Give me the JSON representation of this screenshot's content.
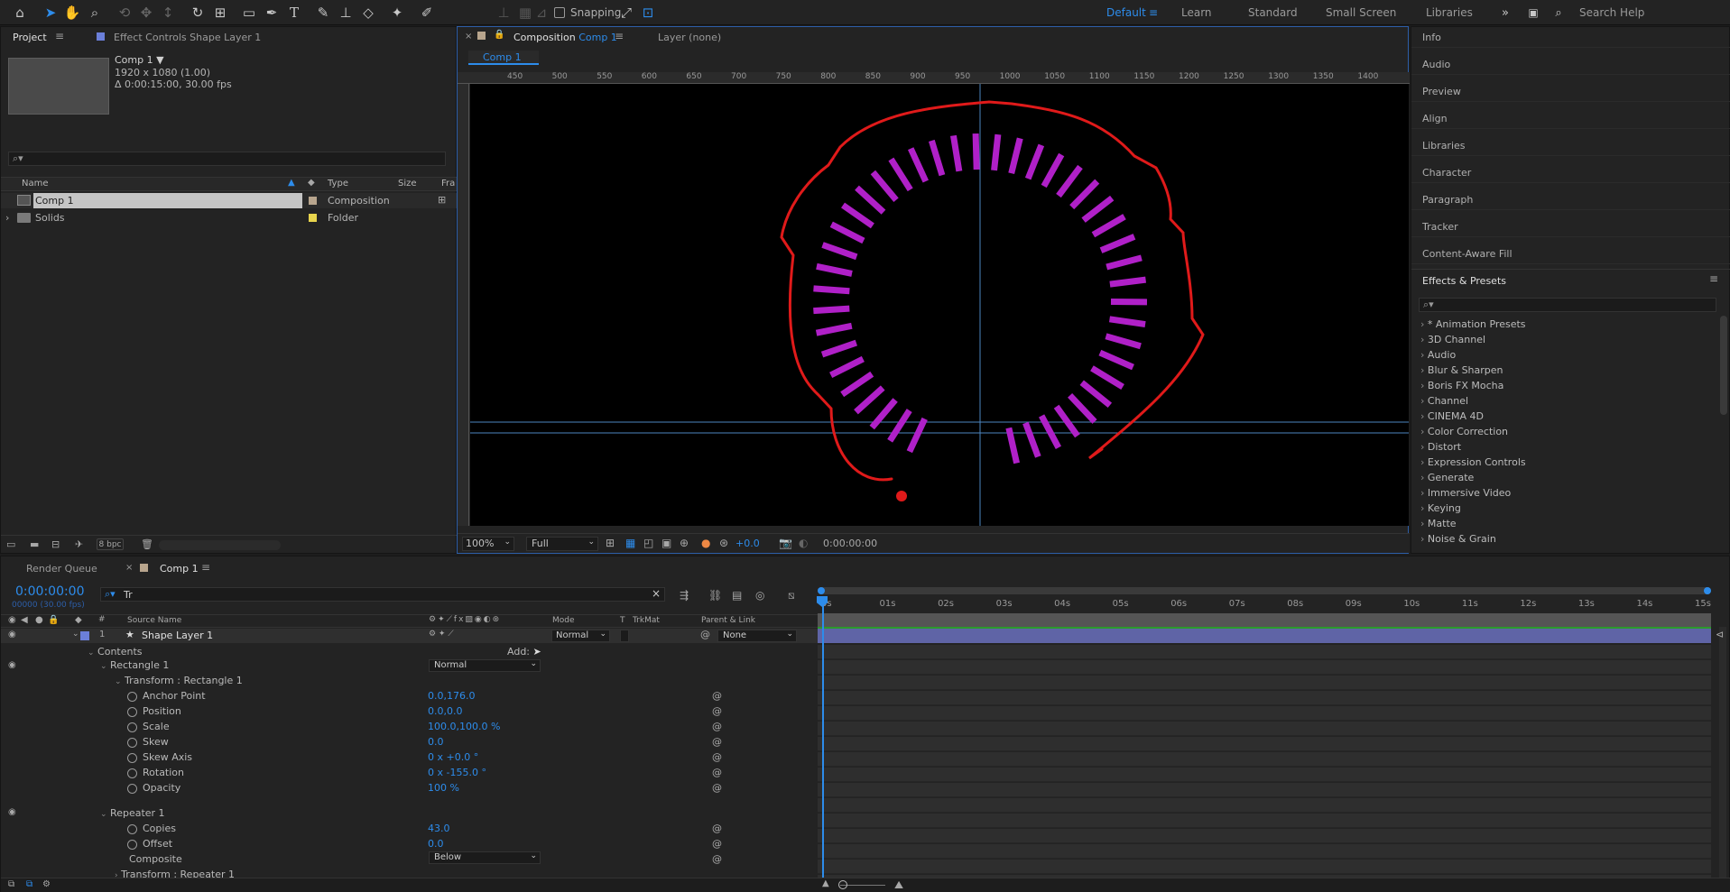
{
  "toolbar": {
    "snapping_label": "Snapping",
    "workspaces": [
      "Default",
      "Learn",
      "Standard",
      "Small Screen",
      "Libraries"
    ],
    "search_placeholder": "Search Help"
  },
  "project": {
    "tab_label": "Project",
    "effect_controls_tab": "Effect Controls Shape Layer 1",
    "comp_name": "Comp 1 ▼",
    "comp_res": "1920 x 1080 (1.00)",
    "comp_dur": "Δ 0:00:15:00, 30.00 fps",
    "search_placeholder": "",
    "columns": [
      "Name",
      "Type",
      "Size",
      "Fra"
    ],
    "items": [
      {
        "name": "Comp 1",
        "type": "Composition"
      },
      {
        "name": "Solids",
        "type": "Folder"
      }
    ],
    "bpc": "8 bpc"
  },
  "composition": {
    "tab_label": "Composition",
    "tab_comp": "Comp 1",
    "layer_tab": "Layer (none)",
    "subtab": "Comp 1",
    "ruler": [
      "450",
      "500",
      "550",
      "600",
      "650",
      "700",
      "750",
      "800",
      "850",
      "900",
      "950",
      "1000",
      "1050",
      "1100",
      "1150",
      "1200",
      "1250",
      "1300",
      "1350",
      "1400"
    ],
    "zoom": "100%",
    "resolution": "Full",
    "exposure": "+0.0",
    "timecode": "0:00:00:00",
    "circle": {
      "bars": 43,
      "bar_color": "#b020c8",
      "stroke_color": "#e01a1a"
    }
  },
  "right_panel": {
    "items": [
      "Info",
      "Audio",
      "Preview",
      "Align",
      "Libraries",
      "Character",
      "Paragraph",
      "Tracker",
      "Content-Aware Fill"
    ],
    "effects_title": "Effects & Presets",
    "effects_search": "",
    "effects": [
      "* Animation Presets",
      "3D Channel",
      "Audio",
      "Blur & Sharpen",
      "Boris FX Mocha",
      "Channel",
      "CINEMA 4D",
      "Color Correction",
      "Distort",
      "Expression Controls",
      "Generate",
      "Immersive Video",
      "Keying",
      "Matte",
      "Noise & Grain"
    ]
  },
  "timeline": {
    "render_queue_tab": "Render Queue",
    "comp_tab": "Comp 1",
    "timecode": "0:00:00:00",
    "frame_info": "00000 (30.00 fps)",
    "search_value": "Tr",
    "col_num": "#",
    "col_source": "Source Name",
    "col_mode": "Mode",
    "col_t": "T",
    "col_trkmat": "TrkMat",
    "col_parent": "Parent & Link",
    "layer": {
      "num": "1",
      "name": "Shape Layer 1",
      "mode": "Normal",
      "parent": "None"
    },
    "contents_label": "Contents",
    "add_label": "Add:",
    "rect_label": "Rectangle 1",
    "rect_mode": "Normal",
    "transform_label": "Transform : Rectangle 1",
    "props": [
      {
        "name": "Anchor Point",
        "value": "0.0,176.0"
      },
      {
        "name": "Position",
        "value": "0.0,0.0"
      },
      {
        "name": "Scale",
        "value": "100.0,100.0 %"
      },
      {
        "name": "Skew",
        "value": "0.0"
      },
      {
        "name": "Skew Axis",
        "value": "0 x +0.0 °"
      },
      {
        "name": "Rotation",
        "value": "0 x -155.0 °"
      },
      {
        "name": "Opacity",
        "value": "100 %"
      }
    ],
    "repeater_label": "Repeater 1",
    "copies_label": "Copies",
    "copies_value": "43.0",
    "offset_label": "Offset",
    "offset_value": "0.0",
    "composite_label": "Composite",
    "composite_value": "Below",
    "transform_rep_label": "Transform : Repeater 1",
    "ticks": [
      "0s",
      "01s",
      "02s",
      "03s",
      "04s",
      "05s",
      "06s",
      "07s",
      "08s",
      "09s",
      "10s",
      "11s",
      "12s",
      "13s",
      "14s",
      "15s"
    ]
  }
}
